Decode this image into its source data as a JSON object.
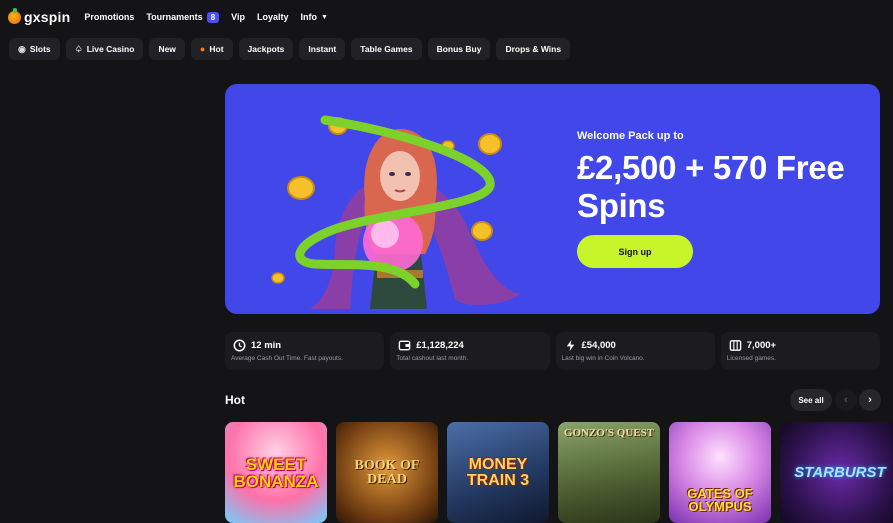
{
  "brand": {
    "name": "gxspin"
  },
  "nav": {
    "promotions": "Promotions",
    "tournaments": "Tournaments",
    "tournaments_badge": "8",
    "vip": "Vip",
    "loyalty": "Loyalty",
    "info": "Info"
  },
  "categories": [
    "Slots",
    "Live Casino",
    "New",
    "Hot",
    "Jackpots",
    "Instant",
    "Table Games",
    "Bonus Buy",
    "Drops & Wins"
  ],
  "hero": {
    "subtitle": "Welcome Pack up to",
    "title": "£2,500 + 570 Free Spins",
    "cta": "Sign up",
    "background_color": "#4147e8",
    "cta_color": "#c7f52a"
  },
  "stats": [
    {
      "icon": "clock-icon",
      "value": "12 min",
      "description": "Average Cash Out Time. Fast payouts."
    },
    {
      "icon": "wallet-icon",
      "value": "£1,128,224",
      "description": "Total cashout last month."
    },
    {
      "icon": "lightning-icon",
      "value": "£54,000",
      "description": "Last big win in Coin Volcano."
    },
    {
      "icon": "games-icon",
      "value": "7,000+",
      "description": "Licensed games."
    }
  ],
  "hot": {
    "title": "Hot",
    "see_all": "See all",
    "games": [
      "Sweet Bonanza",
      "Book of Dead",
      "Money Train 3",
      "Gonzo's Quest",
      "Gates of Olympus",
      "Starburst"
    ]
  }
}
